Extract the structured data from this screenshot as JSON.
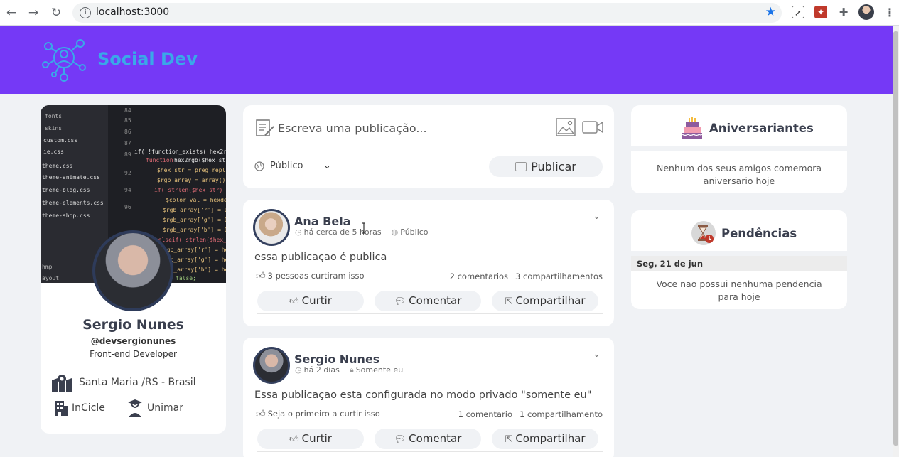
{
  "browser": {
    "url": "localhost:3000"
  },
  "header": {
    "brand": "Social Dev"
  },
  "profile": {
    "name": "Sergio Nunes",
    "handle": "@devsergionunes",
    "role": "Front-end Developer",
    "location": "Santa Maria /RS - Brasil",
    "company": "InCicle",
    "school": "Unimar"
  },
  "composer": {
    "placeholder": "Escreva uma publicação...",
    "privacy": "Público",
    "publish_label": "Publicar"
  },
  "posts": [
    {
      "author": "Ana Bela",
      "time": "há cerca de 5 horas",
      "visibility": "Público",
      "text": "essa publicaçao é publica",
      "likes": "3 pessoas curtiram isso",
      "comments": "2 comentarios",
      "shares": "3 compartilhamentos",
      "like_label": "Curtir",
      "comment_label": "Comentar",
      "share_label": "Compartilhar"
    },
    {
      "author": "Sergio Nunes",
      "time": "há 2 dias",
      "visibility": "Somente eu",
      "text": "Essa publicaçao esta configurada no modo privado \"somente eu\"",
      "likes": "Seja o primeiro a curtir isso",
      "comments": "1 comentario",
      "shares": "1 compartilhamento",
      "like_label": "Curtir",
      "comment_label": "Comentar",
      "share_label": "Compartilhar"
    }
  ],
  "birthdays": {
    "title": "Aniversariantes",
    "message": "Nenhum dos seus amigos comemora aniversario hoje"
  },
  "pending": {
    "title": "Pendências",
    "date": "Seg, 21 de jun",
    "message": "Voce nao possui nenhuma pendencia para hoje"
  },
  "colors": {
    "header_bg": "#7539f6",
    "brand_text": "#3aa8e8",
    "page_bg": "#f0f2f5",
    "avatar_border": "#34405e"
  }
}
